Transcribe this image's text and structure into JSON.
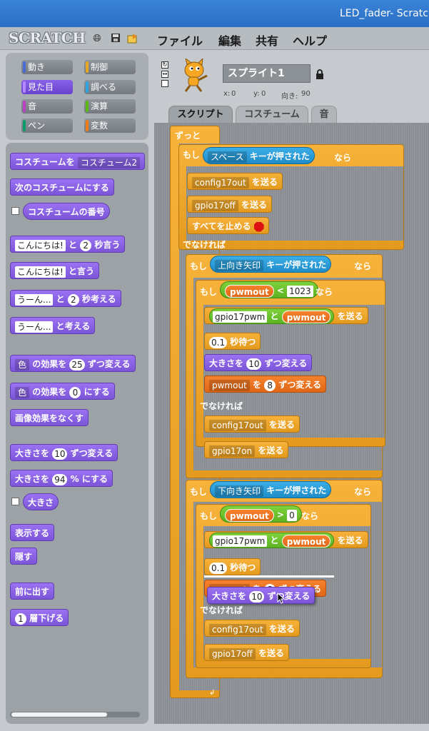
{
  "window": {
    "title": "LED_fader- Scratch"
  },
  "menubar": {
    "logo": "SCRATCH",
    "icons": [
      "globe-icon",
      "save-icon",
      "share-icon"
    ],
    "items": [
      "ファイル",
      "編集",
      "共有",
      "ヘルプ"
    ]
  },
  "categories": [
    "動き",
    "制御",
    "見た目",
    "調べる",
    "音",
    "演算",
    "ペン",
    "変数"
  ],
  "category_colors": [
    "#4a6cd4",
    "#e6a822",
    "#8a55d7",
    "#2ca5e2",
    "#bb42c3",
    "#5cb712",
    "#0e9a6c",
    "#ee7d16"
  ],
  "selected_category": "見た目",
  "palette": {
    "switch_costume": "コスチュームを",
    "switch_costume_value": "コスチューム2",
    "next_costume": "次のコスチュームにする",
    "costume_number": "コスチュームの番号",
    "say_for_text": "こんにちは!",
    "say_for_mid": "と",
    "say_for_secs": "2",
    "say_for_end": "秒言う",
    "say_text": "こんにちは!",
    "say_end": "と言う",
    "think_for_text": "うーん...",
    "think_for_mid": "と",
    "think_for_secs": "2",
    "think_for_end": "秒考える",
    "think_text": "うーん...",
    "think_end": "と考える",
    "change_effect_sel": "色",
    "change_effect_mid": "の効果を",
    "change_effect_val": "25",
    "change_effect_end": "ずつ変える",
    "set_effect_sel": "色",
    "set_effect_mid": "の効果を",
    "set_effect_val": "0",
    "set_effect_end": "にする",
    "clear_effects": "画像効果をなくす",
    "change_size_pre": "大きさを",
    "change_size_val": "10",
    "change_size_end": "ずつ変える",
    "set_size_pre": "大きさを",
    "set_size_val": "94",
    "set_size_end": "% にする",
    "size_reporter": "大きさ",
    "show": "表示する",
    "hide": "隠す",
    "go_front": "前に出す",
    "go_back_val": "1",
    "go_back_end": "層下げる"
  },
  "sprite": {
    "name": "スプライト1",
    "x_label": "x:",
    "x": "0",
    "y_label": "y:",
    "y": "0",
    "direction_label": "向き:",
    "direction": "90"
  },
  "tabs": [
    "スクリプト",
    "コスチューム",
    "音"
  ],
  "active_tab": "スクリプト",
  "script": {
    "forever": "ずっと",
    "if": "もし",
    "then": "なら",
    "else": "でなければ",
    "key_pressed": "キーが押された",
    "key_space": "スペース",
    "key_up": "上向き矢印",
    "key_down": "下向き矢印",
    "broadcast": "を送る",
    "msg_config_out": "config17out",
    "msg_gpio_off": "gpio17off",
    "msg_gpio_on": "gpio17on",
    "stop_all": "すべてを止める",
    "var_pwmout": "pwmout",
    "lt": "<",
    "gt": ">",
    "val_1023": "1023",
    "val_0": "0",
    "join_pre": "gpio17pwm",
    "join_mid": "と",
    "wait_val": "0.1",
    "wait_end": "秒待つ",
    "size_pre": "大きさを",
    "size_val": "10",
    "size_end": "ずつ変える",
    "var_change_by": "を",
    "var_change_val": "8",
    "var_change_end": "ずつ変える",
    "pwmout_hidden": "pwmout"
  }
}
